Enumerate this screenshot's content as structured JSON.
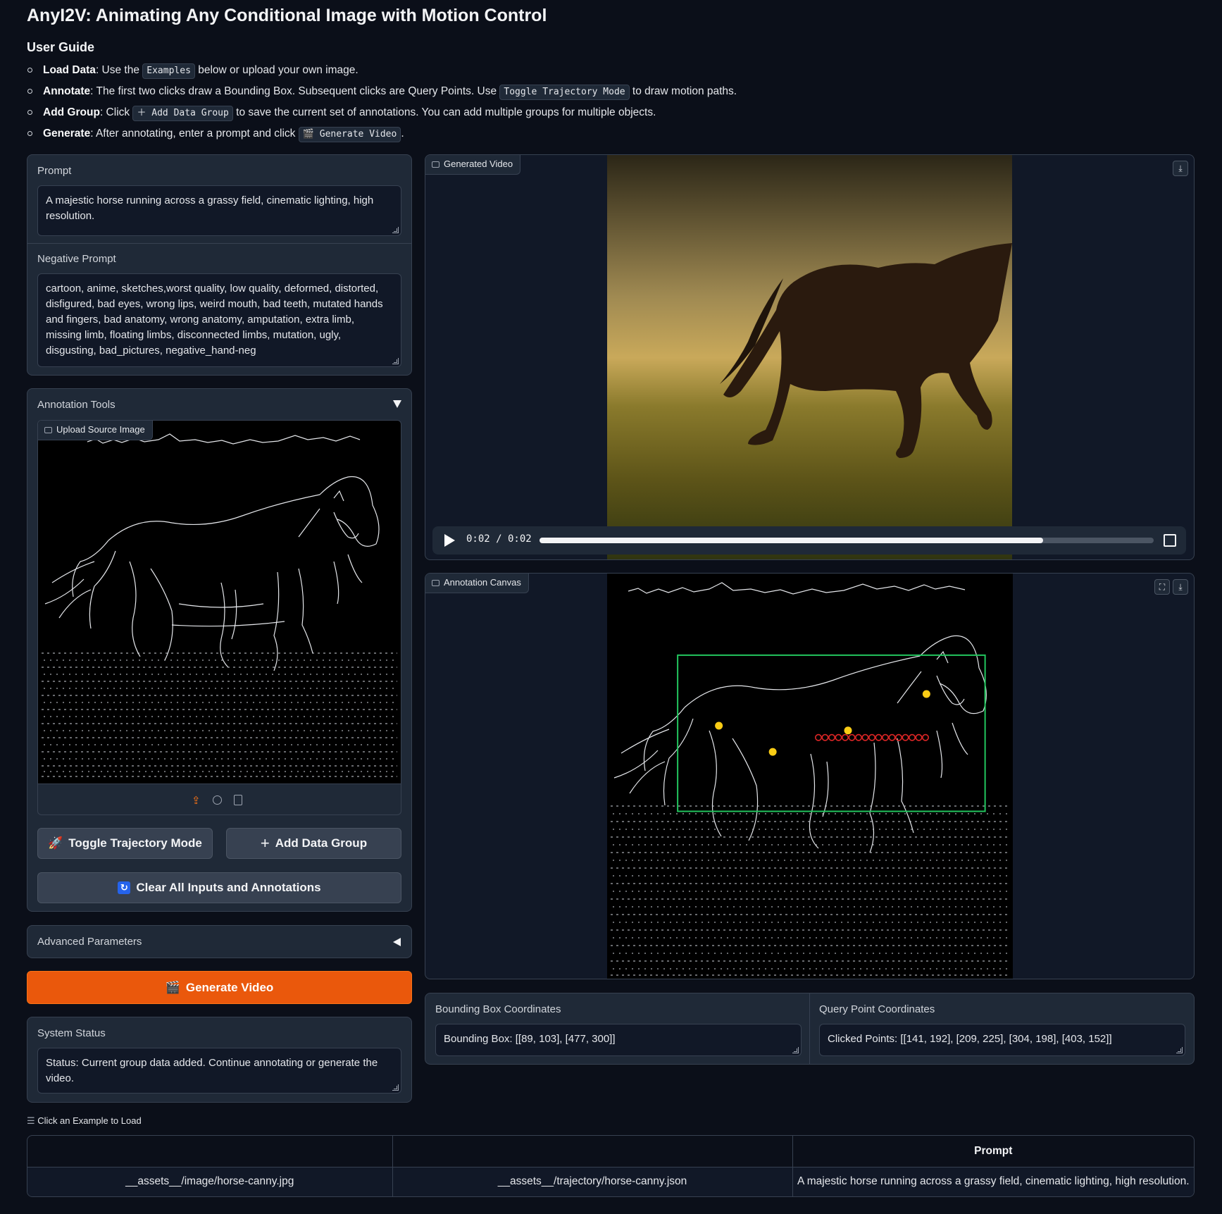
{
  "app": {
    "title": "AnyI2V: Animating Any Conditional Image with Motion Control"
  },
  "guide": {
    "title": "User Guide",
    "items": [
      {
        "bold": "Load Data",
        "before": ": Use the ",
        "code": "Examples",
        "after": " below or upload your own image."
      },
      {
        "bold": "Annotate",
        "before": ": The first two clicks draw a Bounding Box. Subsequent clicks are Query Points. Use ",
        "code": "Toggle Trajectory Mode",
        "after": " to draw motion paths."
      },
      {
        "bold": "Add Group",
        "before": ": Click ",
        "code": "＋ Add Data Group",
        "after": " to save the current set of annotations. You can add multiple groups for multiple objects."
      },
      {
        "bold": "Generate",
        "before": ": After annotating, enter a prompt and click ",
        "code": "🎬 Generate Video",
        "after": "."
      }
    ]
  },
  "prompt": {
    "label": "Prompt",
    "value": "A majestic horse running across a grassy field, cinematic lighting, high resolution."
  },
  "negative_prompt": {
    "label": "Negative Prompt",
    "value": "cartoon, anime, sketches,worst quality, low quality, deformed, distorted, disfigured, bad eyes, wrong lips, weird mouth, bad teeth, mutated hands and fingers, bad anatomy, wrong anatomy, amputation, extra limb, missing limb, floating limbs, disconnected limbs, mutation, ugly, disgusting, bad_pictures, negative_hand-neg"
  },
  "annotation_tools": {
    "label": "Annotation Tools",
    "upload_label": "Upload Source Image",
    "toggle_trajectory": "Toggle Trajectory Mode",
    "add_group": "Add Data Group",
    "clear_all": "Clear All Inputs and Annotations"
  },
  "advanced": {
    "label": "Advanced Parameters"
  },
  "generate": {
    "label": "Generate Video"
  },
  "status": {
    "label": "System Status",
    "value": "Status: Current group data added. Continue annotating or generate the video."
  },
  "video": {
    "label": "Generated Video",
    "time": "0:02 / 0:02",
    "progress": 0.82
  },
  "canvas": {
    "label": "Annotation Canvas"
  },
  "bbox": {
    "label": "Bounding Box Coordinates",
    "value": "Bounding Box: [[89, 103], [477, 300]]"
  },
  "points": {
    "label": "Query Point Coordinates",
    "value": "Clicked Points: [[141, 192], [209, 225], [304, 198], [403, 152]]"
  },
  "examples": {
    "label": "Click an Example to Load",
    "headers": [
      "",
      "",
      "Prompt"
    ],
    "rows": [
      [
        "__assets__/image/horse-canny.jpg",
        "__assets__/trajectory/horse-canny.json",
        "A majestic horse running across a grassy field, cinematic lighting, high resolution."
      ]
    ]
  },
  "colors": {
    "accent": "#ea580c",
    "bbox": "#22c55e",
    "point": "#facc15",
    "trajectory": "#dc2626"
  },
  "icons": [
    "image-icon",
    "video-icon",
    "download-icon",
    "fullscreen-icon",
    "close-icon",
    "upload-icon",
    "webcam-icon",
    "clipboard-icon",
    "rocket-icon",
    "plus-icon",
    "refresh-icon",
    "clapper-icon",
    "play-icon",
    "list-icon",
    "triangle-down-icon",
    "triangle-left-icon"
  ]
}
